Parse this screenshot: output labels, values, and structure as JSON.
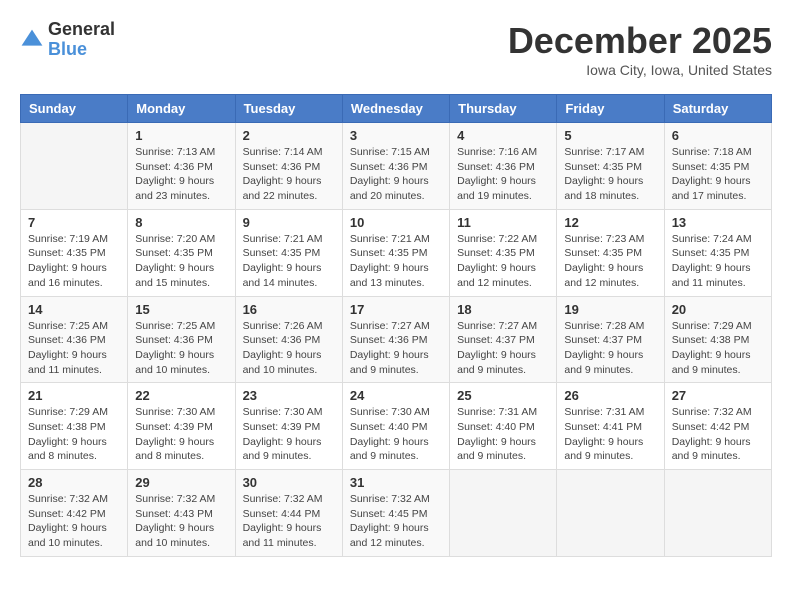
{
  "logo": {
    "general": "General",
    "blue": "Blue"
  },
  "header": {
    "month": "December 2025",
    "location": "Iowa City, Iowa, United States"
  },
  "weekdays": [
    "Sunday",
    "Monday",
    "Tuesday",
    "Wednesday",
    "Thursday",
    "Friday",
    "Saturday"
  ],
  "weeks": [
    [
      {
        "day": null
      },
      {
        "day": 1,
        "sunrise": "7:13 AM",
        "sunset": "4:36 PM",
        "daylight": "9 hours and 23 minutes."
      },
      {
        "day": 2,
        "sunrise": "7:14 AM",
        "sunset": "4:36 PM",
        "daylight": "9 hours and 22 minutes."
      },
      {
        "day": 3,
        "sunrise": "7:15 AM",
        "sunset": "4:36 PM",
        "daylight": "9 hours and 20 minutes."
      },
      {
        "day": 4,
        "sunrise": "7:16 AM",
        "sunset": "4:36 PM",
        "daylight": "9 hours and 19 minutes."
      },
      {
        "day": 5,
        "sunrise": "7:17 AM",
        "sunset": "4:35 PM",
        "daylight": "9 hours and 18 minutes."
      },
      {
        "day": 6,
        "sunrise": "7:18 AM",
        "sunset": "4:35 PM",
        "daylight": "9 hours and 17 minutes."
      }
    ],
    [
      {
        "day": 7,
        "sunrise": "7:19 AM",
        "sunset": "4:35 PM",
        "daylight": "9 hours and 16 minutes."
      },
      {
        "day": 8,
        "sunrise": "7:20 AM",
        "sunset": "4:35 PM",
        "daylight": "9 hours and 15 minutes."
      },
      {
        "day": 9,
        "sunrise": "7:21 AM",
        "sunset": "4:35 PM",
        "daylight": "9 hours and 14 minutes."
      },
      {
        "day": 10,
        "sunrise": "7:21 AM",
        "sunset": "4:35 PM",
        "daylight": "9 hours and 13 minutes."
      },
      {
        "day": 11,
        "sunrise": "7:22 AM",
        "sunset": "4:35 PM",
        "daylight": "9 hours and 12 minutes."
      },
      {
        "day": 12,
        "sunrise": "7:23 AM",
        "sunset": "4:35 PM",
        "daylight": "9 hours and 12 minutes."
      },
      {
        "day": 13,
        "sunrise": "7:24 AM",
        "sunset": "4:35 PM",
        "daylight": "9 hours and 11 minutes."
      }
    ],
    [
      {
        "day": 14,
        "sunrise": "7:25 AM",
        "sunset": "4:36 PM",
        "daylight": "9 hours and 11 minutes."
      },
      {
        "day": 15,
        "sunrise": "7:25 AM",
        "sunset": "4:36 PM",
        "daylight": "9 hours and 10 minutes."
      },
      {
        "day": 16,
        "sunrise": "7:26 AM",
        "sunset": "4:36 PM",
        "daylight": "9 hours and 10 minutes."
      },
      {
        "day": 17,
        "sunrise": "7:27 AM",
        "sunset": "4:36 PM",
        "daylight": "9 hours and 9 minutes."
      },
      {
        "day": 18,
        "sunrise": "7:27 AM",
        "sunset": "4:37 PM",
        "daylight": "9 hours and 9 minutes."
      },
      {
        "day": 19,
        "sunrise": "7:28 AM",
        "sunset": "4:37 PM",
        "daylight": "9 hours and 9 minutes."
      },
      {
        "day": 20,
        "sunrise": "7:29 AM",
        "sunset": "4:38 PM",
        "daylight": "9 hours and 9 minutes."
      }
    ],
    [
      {
        "day": 21,
        "sunrise": "7:29 AM",
        "sunset": "4:38 PM",
        "daylight": "9 hours and 8 minutes."
      },
      {
        "day": 22,
        "sunrise": "7:30 AM",
        "sunset": "4:39 PM",
        "daylight": "9 hours and 8 minutes."
      },
      {
        "day": 23,
        "sunrise": "7:30 AM",
        "sunset": "4:39 PM",
        "daylight": "9 hours and 9 minutes."
      },
      {
        "day": 24,
        "sunrise": "7:30 AM",
        "sunset": "4:40 PM",
        "daylight": "9 hours and 9 minutes."
      },
      {
        "day": 25,
        "sunrise": "7:31 AM",
        "sunset": "4:40 PM",
        "daylight": "9 hours and 9 minutes."
      },
      {
        "day": 26,
        "sunrise": "7:31 AM",
        "sunset": "4:41 PM",
        "daylight": "9 hours and 9 minutes."
      },
      {
        "day": 27,
        "sunrise": "7:32 AM",
        "sunset": "4:42 PM",
        "daylight": "9 hours and 9 minutes."
      }
    ],
    [
      {
        "day": 28,
        "sunrise": "7:32 AM",
        "sunset": "4:42 PM",
        "daylight": "9 hours and 10 minutes."
      },
      {
        "day": 29,
        "sunrise": "7:32 AM",
        "sunset": "4:43 PM",
        "daylight": "9 hours and 10 minutes."
      },
      {
        "day": 30,
        "sunrise": "7:32 AM",
        "sunset": "4:44 PM",
        "daylight": "9 hours and 11 minutes."
      },
      {
        "day": 31,
        "sunrise": "7:32 AM",
        "sunset": "4:45 PM",
        "daylight": "9 hours and 12 minutes."
      },
      {
        "day": null
      },
      {
        "day": null
      },
      {
        "day": null
      }
    ]
  ],
  "labels": {
    "sunrise_prefix": "Sunrise: ",
    "sunset_prefix": "Sunset: ",
    "daylight_prefix": "Daylight: "
  }
}
